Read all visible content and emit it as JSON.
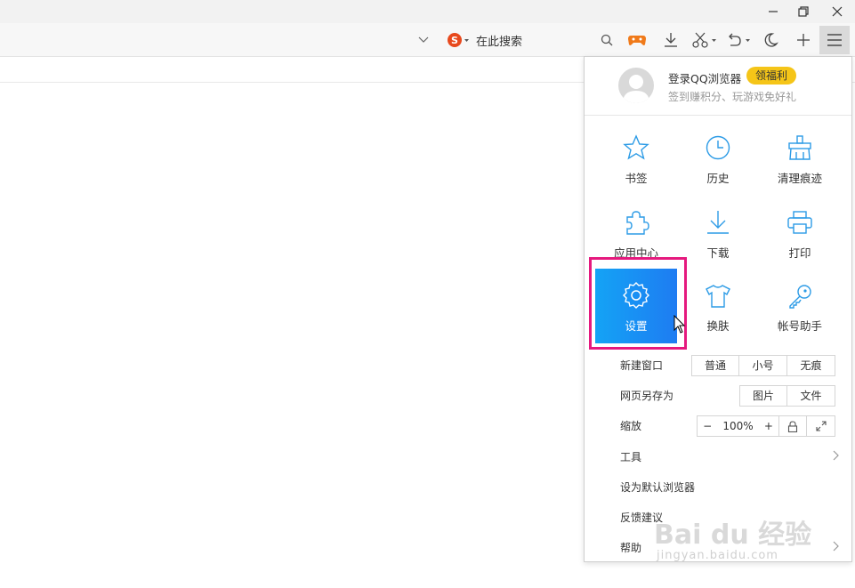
{
  "titlebar": {
    "minimize": "minimize",
    "restore": "restore",
    "close": "close"
  },
  "toolbar": {
    "search_placeholder": "在此搜索"
  },
  "menu": {
    "profile": {
      "login": "登录QQ浏览器",
      "badge": "领福利",
      "subtitle": "签到赚积分、玩游戏免好礼"
    },
    "grid": [
      {
        "label": "书签",
        "icon": "star-icon"
      },
      {
        "label": "历史",
        "icon": "clock-icon"
      },
      {
        "label": "清理痕迹",
        "icon": "broom-icon"
      },
      {
        "label": "应用中心",
        "icon": "puzzle-icon"
      },
      {
        "label": "下载",
        "icon": "download-icon"
      },
      {
        "label": "打印",
        "icon": "printer-icon"
      },
      {
        "label": "设置",
        "icon": "gear-icon"
      },
      {
        "label": "换肤",
        "icon": "shirt-icon"
      },
      {
        "label": "帐号助手",
        "icon": "key-icon"
      }
    ],
    "new_window": {
      "label": "新建窗口",
      "normal": "普通",
      "small": "小号",
      "private": "无痕"
    },
    "save_as": {
      "label": "网页另存为",
      "image": "图片",
      "file": "文件"
    },
    "zoom": {
      "label": "缩放",
      "minus": "−",
      "value": "100%",
      "plus": "+"
    },
    "tools": "工具",
    "set_default": "设为默认浏览器",
    "feedback": "反馈建议",
    "help": "帮助"
  },
  "watermark": {
    "main": "Bai du 经验",
    "sub": "jingyan.baidu.com"
  },
  "colors": {
    "accent": "#1e90f0",
    "highlight": "#e5197e",
    "badge": "#f5c518"
  }
}
